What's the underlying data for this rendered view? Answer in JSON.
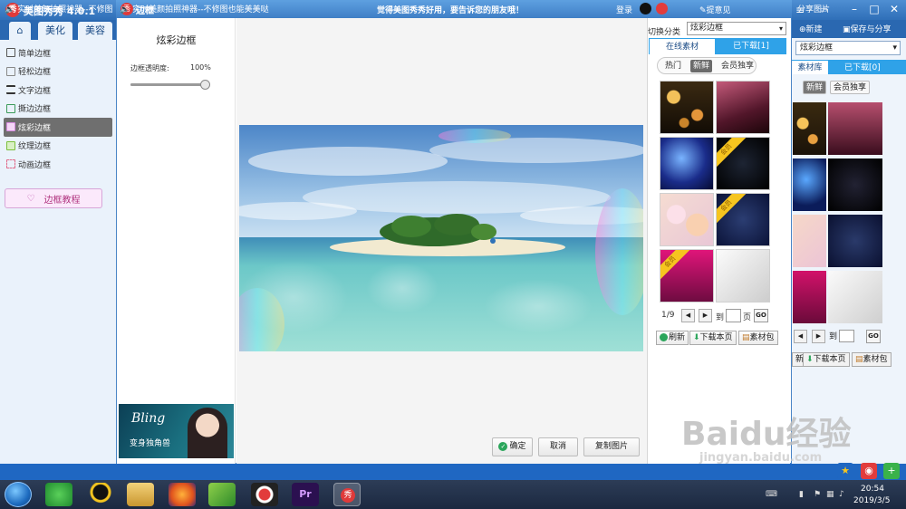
{
  "app": {
    "title": "美图秀秀 4.0.1",
    "tabs": [
      "美化",
      "美容"
    ],
    "side_menu": [
      "简单边框",
      "轻松边框",
      "文字边框",
      "撕边边框",
      "炫彩边框",
      "纹理边框",
      "动画边框"
    ],
    "active_side_item": "炫彩边框",
    "tutorial_button": "边框教程",
    "right_actions": [
      "新建",
      "保存与分享"
    ],
    "right_select": "炫彩边框",
    "right_tabs": [
      "素材库",
      "已下载[0]"
    ],
    "right_chips": [
      "新鲜",
      "会员独享"
    ],
    "right_pager": "到",
    "right_go": "GO",
    "right_buttons": [
      "新",
      "下载本页",
      "素材包"
    ]
  },
  "dialog": {
    "title": "边框",
    "slogan": "觉得美图秀秀好用，要告诉您的朋友哦！",
    "login": "登录",
    "feedback": "提意见",
    "panel_heading": "炫彩边框",
    "opacity_label": "边框透明度:",
    "opacity_value": "100%",
    "opacity_level": 1.0,
    "ad": {
      "script_text": "Bling",
      "caption": "变身独角兽"
    },
    "buttons": {
      "ok": "确定",
      "cancel": "取消",
      "copy": "复制图片"
    }
  },
  "materials": {
    "switch_label": "切换分类",
    "switch_value": "炫彩边框",
    "tabs": [
      "在线素材",
      "已下载[1]"
    ],
    "chips": [
      "热门",
      "新鲜",
      "会员独享"
    ],
    "active_chip": "新鲜",
    "vip_badge": "会员",
    "page_info": "1/9",
    "goto_label": "到",
    "page_label": "页",
    "go": "GO",
    "actions": [
      "刷新",
      "下载本页",
      "素材包"
    ]
  },
  "status": {
    "tip": "实时美颜拍照神器--不修图也能美美哒",
    "tip_truncated": "实时美颜拍照神器--不修图",
    "share_label": "分享图片"
  },
  "taskbar": {
    "time": "20:54",
    "date": "2019/3/5"
  },
  "watermark": {
    "brand": "Baidu经验",
    "url": "jingyan.baidu.com"
  },
  "colors": {
    "title_blue": "#3f7fc6",
    "tab_blue": "#2fa2e8",
    "tip_blue": "#1f67c2",
    "accent_green": "#2aa55a"
  }
}
